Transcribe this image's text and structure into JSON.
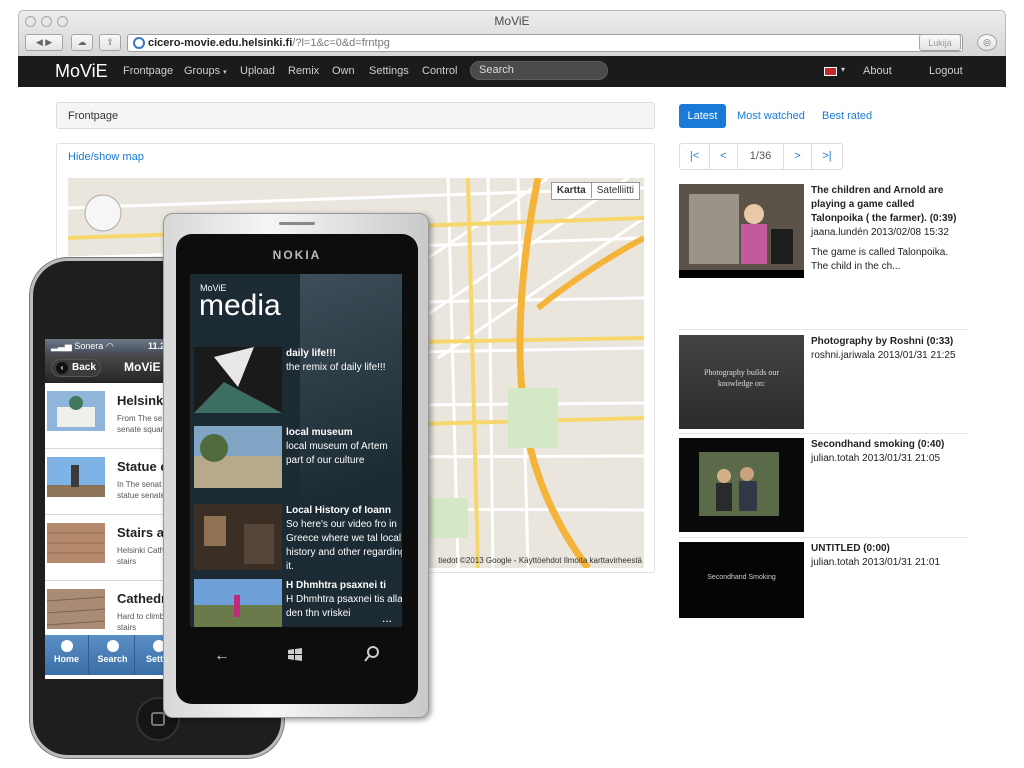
{
  "browser": {
    "title": "MoViE",
    "url_host": "cicero-movie.edu.helsinki.fi",
    "url_rest": "/?l=1&c=0&d=frntpg",
    "reader_label": "Lukija"
  },
  "navbar": {
    "brand": "MoViE",
    "items": [
      "Frontpage",
      "Groups",
      "Upload",
      "Remix",
      "Own",
      "Settings",
      "Control"
    ],
    "search_placeholder": "Search",
    "about": "About",
    "logout": "Logout"
  },
  "breadcrumb": "Frontpage",
  "map": {
    "toggle": "Hide/show map",
    "tab_map": "Kartta",
    "tab_satellite": "Satelliitti",
    "footer": "tiedot ©2013 Google - Käyttöehdot  Ilmoita karttavirheestä"
  },
  "tabs": {
    "latest": "Latest",
    "most_watched": "Most watched",
    "best_rated": "Best rated"
  },
  "pager": [
    "|<",
    "<",
    "1/36",
    ">",
    ">|"
  ],
  "videos": [
    {
      "title": "The children and Arnold are playing a game called Talonpoika ( the farmer). (0:39)",
      "meta": "jaana.lundén 2013/02/08 15:32",
      "desc": "The game is called Talonpoika. The child in the ch..."
    },
    {
      "title": "Photography by Roshni (0:33)",
      "meta": "roshni.jariwala 2013/01/31 21:25",
      "thumb_text": "Photography builds our knowledge on:"
    },
    {
      "title": "Secondhand smoking (0:40)",
      "meta": "julian.totah 2013/01/31 21:05",
      "thumb_text": "Secondhand Smoking"
    },
    {
      "title": "UNTITLED (0:00)",
      "meta": "julian.totah 2013/01/31 21:01",
      "thumb_text": "Secondhand Smoking"
    }
  ],
  "iphone": {
    "carrier": "Sonera",
    "time": "11.2",
    "back": "Back",
    "title": "MoViE m",
    "items": [
      {
        "title": "Helsinki (",
        "sub": "From The se\nsenate squar"
      },
      {
        "title": "Statue of",
        "sub": "In The senat\nstatue senate"
      },
      {
        "title": "Stairs an",
        "sub": "Helsinki Cath\nstairs"
      },
      {
        "title": "Cathedra",
        "sub": "Hard to climb\nstairs"
      }
    ],
    "tabs": [
      "Home",
      "Search",
      "Settin"
    ]
  },
  "nokia": {
    "brand": "NOKIA",
    "app": "MoViE",
    "heading": "media",
    "items": [
      {
        "title": "daily life!!!",
        "desc": "the remix of daily life!!!"
      },
      {
        "title": "local museum",
        "desc": "local museum of Artem part of our culture"
      },
      {
        "title": "Local History of Ioann",
        "desc": "So here's our video fro in Greece where we tal local history and other regarding it."
      },
      {
        "title": "H Dhmhtra psaxnei ti",
        "desc": "H Dhmhtra psaxnei tis alla den thn vriskei"
      }
    ],
    "more": "..."
  },
  "colors": {
    "accent": "#1a7bd6",
    "navbar": "#1b1b1b",
    "iphone_tabbar": "#4a80b8"
  }
}
